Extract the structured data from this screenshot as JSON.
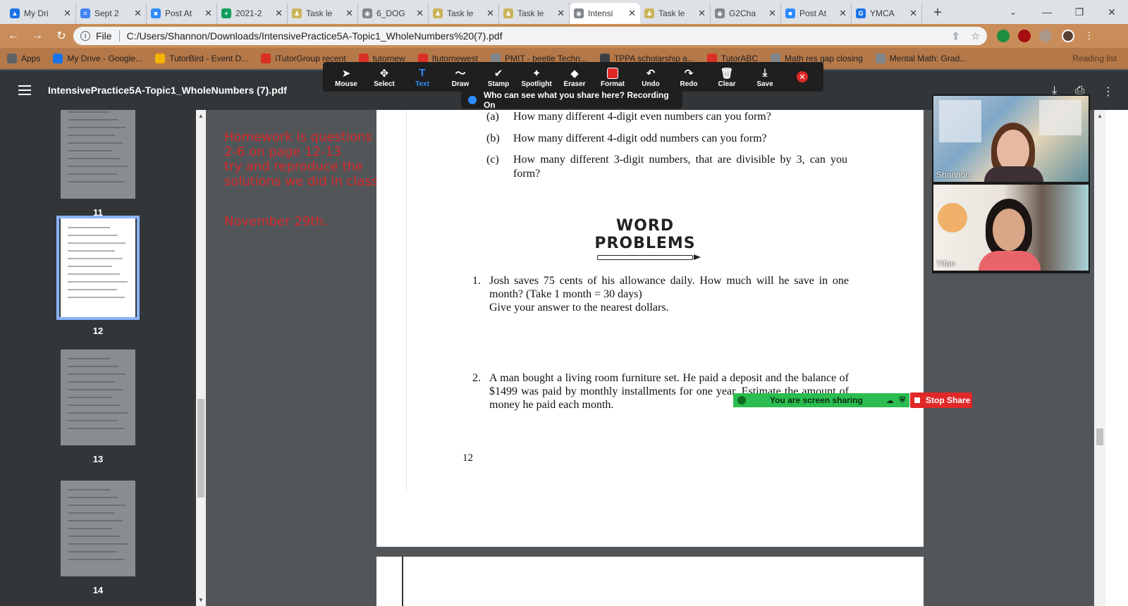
{
  "browser": {
    "tabs": [
      {
        "title": "My Dri",
        "color": "#1a73e8",
        "glyph": "▲"
      },
      {
        "title": "Sept 2",
        "color": "#4285f4",
        "glyph": "≡"
      },
      {
        "title": "Post At",
        "color": "#2d8cff",
        "glyph": "■"
      },
      {
        "title": "2021-2",
        "color": "#0f9d58",
        "glyph": "+"
      },
      {
        "title": "Task le",
        "color": "#c9b458",
        "glyph": "♟"
      },
      {
        "title": "6_DOG",
        "color": "#80868b",
        "glyph": "◉"
      },
      {
        "title": "Task le",
        "color": "#c9b458",
        "glyph": "♟"
      },
      {
        "title": "Task le",
        "color": "#c9b458",
        "glyph": "♟"
      },
      {
        "title": "Intensi",
        "color": "#80868b",
        "glyph": "◉"
      },
      {
        "title": "Task le",
        "color": "#c9b458",
        "glyph": "♟"
      },
      {
        "title": "G2Cha",
        "color": "#80868b",
        "glyph": "◉"
      },
      {
        "title": "Post At",
        "color": "#2d8cff",
        "glyph": "■"
      },
      {
        "title": "YMCA",
        "color": "#1a73e8",
        "glyph": "G"
      }
    ],
    "active_tab_index": 8,
    "address": {
      "scheme_label": "File",
      "url": "C:/Users/Shannon/Downloads/IntensivePractice5A-Topic1_WholeNumbers%20(7).pdf"
    },
    "bookmarks": [
      {
        "label": "Apps",
        "color": "#5f6368"
      },
      {
        "label": "My Drive - Google...",
        "color": "#1a73e8"
      },
      {
        "label": "TutorBird - Event D...",
        "color": "#f4b400"
      },
      {
        "label": "iTutorGroup recent",
        "color": "#d93025"
      },
      {
        "label": "tutornew",
        "color": "#d93025"
      },
      {
        "label": "Itutornewest",
        "color": "#d93025"
      },
      {
        "label": "PMIT - beetle Techn...",
        "color": "#80868b"
      },
      {
        "label": "TPPA scholarship a...",
        "color": "#3c4043"
      },
      {
        "label": "TutorABC",
        "color": "#d93025"
      },
      {
        "label": "Math res gap closing",
        "color": "#80868b"
      },
      {
        "label": "Mental Math: Grad...",
        "color": "#80868b"
      }
    ],
    "reading_list": "Reading list"
  },
  "pdf": {
    "title": "IntensivePractice5A-Topic1_WholeNumbers (7).pdf",
    "thumbnails": [
      {
        "page": "11",
        "selected": false
      },
      {
        "page": "12",
        "selected": true
      },
      {
        "page": "13",
        "selected": false
      },
      {
        "page": "14",
        "selected": false
      }
    ]
  },
  "zoom_toolbar": {
    "tools": [
      {
        "label": "Mouse",
        "glyph": "➤",
        "active": false
      },
      {
        "label": "Select",
        "glyph": "✥",
        "active": false
      },
      {
        "label": "Text",
        "glyph": "T",
        "active": true
      },
      {
        "label": "Draw",
        "glyph": "〜",
        "active": false
      },
      {
        "label": "Stamp",
        "glyph": "✔",
        "active": false
      },
      {
        "label": "Spotlight",
        "glyph": "✦",
        "active": false
      },
      {
        "label": "Eraser",
        "glyph": "◆",
        "active": false
      },
      {
        "label": "Format",
        "glyph": "■",
        "active": false
      },
      {
        "label": "Undo",
        "glyph": "↶",
        "active": false
      },
      {
        "label": "Redo",
        "glyph": "↷",
        "active": false
      },
      {
        "label": "Clear",
        "glyph": "🗑",
        "active": false
      },
      {
        "label": "Save",
        "glyph": "⤓",
        "active": false
      }
    ],
    "recording_notice": "Who can see what you share here? Recording On"
  },
  "annotation": {
    "lines": [
      "Homework is questions",
      "2-6 on page 12-13",
      "try and reproduce the",
      "solutions we did in class.",
      "",
      "November 29th."
    ]
  },
  "page": {
    "questions": [
      {
        "label": "(a)",
        "text": "How many different 4-digit even numbers can you form?"
      },
      {
        "label": "(b)",
        "text": "How many different 4-digit odd numbers can you form?"
      },
      {
        "label": "(c)",
        "text": "How many different 3-digit numbers, that are divisible by 3, can you form?"
      }
    ],
    "heading": "WORD PROBLEMS",
    "problems": [
      {
        "num": "1.",
        "text": "Josh saves 75 cents of his allowance daily. How much will he save in one month? (Take 1 month = 30 days)",
        "extra": "Give your answer to the nearest dollars."
      },
      {
        "num": "2.",
        "text": "A man bought a living room furniture set. He paid a deposit and the balance of $1499 was paid by monthly installments for one year. Estimate the amount of money he paid each month.",
        "extra": ""
      }
    ],
    "page_number": "12"
  },
  "video": {
    "participants": [
      {
        "name": "Shannon"
      },
      {
        "name": "Yifan"
      }
    ]
  },
  "share": {
    "banner": "You are screen sharing",
    "stop_label": "Stop Share"
  }
}
